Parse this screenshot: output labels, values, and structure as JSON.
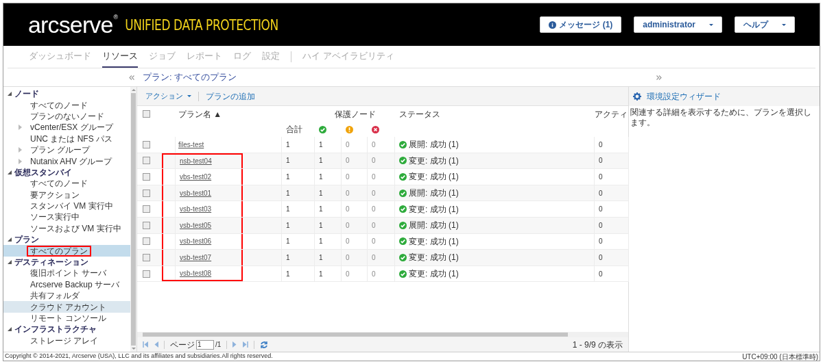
{
  "header": {
    "logo": "arcserve",
    "logo_mark": "®",
    "product": "UNIFIED DATA PROTECTION",
    "buttons": [
      {
        "kind": "info",
        "label": "メッセージ (1)"
      },
      {
        "kind": "dropdown",
        "label": "administrator"
      },
      {
        "kind": "dropdown",
        "label": "ヘルプ"
      }
    ]
  },
  "nav": {
    "tabs": [
      {
        "label": "ダッシュボード",
        "selected": false
      },
      {
        "label": "リソース",
        "selected": true
      },
      {
        "label": "ジョブ",
        "selected": false
      },
      {
        "label": "レポート",
        "selected": false
      },
      {
        "label": "ログ",
        "selected": false
      },
      {
        "label": "設定",
        "selected": false
      }
    ],
    "extra_tab": {
      "label": "ハイ アベイラビリティ",
      "selected": false
    }
  },
  "breadcrumb": "プラン: すべてのプラン",
  "sidebar": {
    "groups": [
      {
        "label": "ノード",
        "expanded": true,
        "children": [
          {
            "label": "すべてのノード",
            "selected": false,
            "hovered": false,
            "annotated": false
          },
          {
            "label": "プランのないノード",
            "selected": false,
            "hovered": false,
            "annotated": false
          },
          {
            "label": "vCenter/ESX グループ",
            "selected": false,
            "hovered": false,
            "annotated": false,
            "expanded": false
          },
          {
            "label": "UNC または NFS パス",
            "selected": false,
            "hovered": false,
            "annotated": false
          },
          {
            "label": "プラン グループ",
            "selected": false,
            "hovered": false,
            "annotated": false,
            "expanded": false
          },
          {
            "label": "Nutanix AHV グループ",
            "selected": false,
            "hovered": false,
            "annotated": false,
            "expanded": false
          }
        ]
      },
      {
        "label": "仮想スタンバイ",
        "expanded": true,
        "children": [
          {
            "label": "すべてのノード",
            "selected": false,
            "hovered": false,
            "annotated": false
          },
          {
            "label": "要アクション",
            "selected": false,
            "hovered": false,
            "annotated": false
          },
          {
            "label": "スタンバイ VM 実行中",
            "selected": false,
            "hovered": false,
            "annotated": false
          },
          {
            "label": "ソース実行中",
            "selected": false,
            "hovered": false,
            "annotated": false
          },
          {
            "label": "ソースおよび VM 実行中",
            "selected": false,
            "hovered": false,
            "annotated": false
          }
        ]
      },
      {
        "label": "プラン",
        "expanded": true,
        "children": [
          {
            "label": "すべてのプラン",
            "selected": true,
            "hovered": false,
            "annotated": true
          }
        ]
      },
      {
        "label": "デスティネーション",
        "expanded": true,
        "children": [
          {
            "label": "復旧ポイント サーバ",
            "selected": false,
            "hovered": false,
            "annotated": false
          },
          {
            "label": "Arcserve Backup サーバ",
            "selected": false,
            "hovered": false,
            "annotated": false
          },
          {
            "label": "共有フォルダ",
            "selected": false,
            "hovered": false,
            "annotated": false
          },
          {
            "label": "クラウド アカウント",
            "selected": false,
            "hovered": true,
            "annotated": false
          },
          {
            "label": "リモート コンソール",
            "selected": false,
            "hovered": false,
            "annotated": false
          }
        ]
      },
      {
        "label": "インフラストラクチャ",
        "expanded": true,
        "children": [
          {
            "label": "ストレージ アレイ",
            "selected": false,
            "hovered": false,
            "annotated": false
          }
        ]
      }
    ]
  },
  "toolbar": {
    "actions": "アクション",
    "add": "プランの追加"
  },
  "table": {
    "select_all_checked": false,
    "columns": {
      "name": "プラン名 ▲",
      "nodes": "保護ノード",
      "total": "合計",
      "status": "ステータス",
      "column_6": "アクティ"
    },
    "rows": [
      {
        "checked": false,
        "name": "files-test",
        "annotated": false,
        "total": "1",
        "ok": "1",
        "warn": "0",
        "error": "0",
        "succeeded": true,
        "status": "展開: 成功 (1)",
        "column_6": "0"
      },
      {
        "checked": false,
        "name": "nsb-test04",
        "annotated": true,
        "total": "1",
        "ok": "1",
        "warn": "0",
        "error": "0",
        "succeeded": true,
        "status": "変更: 成功 (1)",
        "column_6": "0"
      },
      {
        "checked": false,
        "name": "vbs-test02",
        "annotated": true,
        "total": "1",
        "ok": "1",
        "warn": "0",
        "error": "0",
        "succeeded": true,
        "status": "変更: 成功 (1)",
        "column_6": "0"
      },
      {
        "checked": false,
        "name": "vsb-test01",
        "annotated": true,
        "total": "1",
        "ok": "1",
        "warn": "0",
        "error": "0",
        "succeeded": true,
        "status": "展開: 成功 (1)",
        "column_6": "0"
      },
      {
        "checked": false,
        "name": "vsb-test03",
        "annotated": true,
        "total": "1",
        "ok": "1",
        "warn": "0",
        "error": "0",
        "succeeded": true,
        "status": "変更: 成功 (1)",
        "column_6": "0"
      },
      {
        "checked": false,
        "name": "vsb-test05",
        "annotated": true,
        "total": "1",
        "ok": "1",
        "warn": "0",
        "error": "0",
        "succeeded": true,
        "status": "展開: 成功 (1)",
        "column_6": "0"
      },
      {
        "checked": false,
        "name": "vsb-test06",
        "annotated": true,
        "total": "1",
        "ok": "1",
        "warn": "0",
        "error": "0",
        "succeeded": true,
        "status": "変更: 成功 (1)",
        "column_6": "0"
      },
      {
        "checked": false,
        "name": "vsb-test07",
        "annotated": true,
        "total": "1",
        "ok": "1",
        "warn": "0",
        "error": "0",
        "succeeded": true,
        "status": "変更: 成功 (1)",
        "column_6": "0"
      },
      {
        "checked": false,
        "name": "vsb-test08",
        "annotated": true,
        "total": "1",
        "ok": "1",
        "warn": "0",
        "error": "0",
        "succeeded": true,
        "status": "変更: 成功 (1)",
        "column_6": "0"
      }
    ]
  },
  "pager": {
    "page_label": "ページ",
    "page": "1",
    "of": "/1",
    "summary": "1 - 9/9 の表示"
  },
  "right_panel": {
    "wizard": "環境設定ウィザード",
    "message": "関連する詳細を表示するために、プランを選択します。"
  },
  "footer": {
    "copyright": "Copyright © 2014-2021, Arcserve (USA), LLC and its affiliates and subsidiaries.All rights reserved.",
    "timezone": "UTC+09:00 (日本標準時)"
  }
}
